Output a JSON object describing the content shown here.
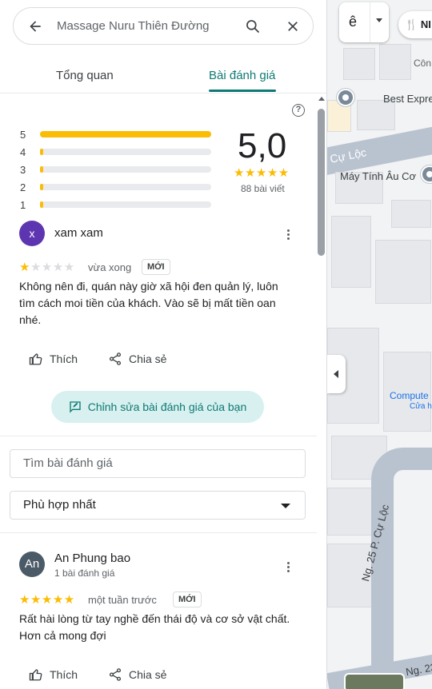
{
  "search": {
    "query": "Massage Nuru Thiên Đường"
  },
  "tabs": [
    {
      "label": "Tổng quan"
    },
    {
      "label": "Bài đánh giá"
    }
  ],
  "summary": {
    "score": "5,0",
    "count": "88 bài viết",
    "stars": "★★★★★",
    "histogram": [
      {
        "label": "5",
        "fraction": 1.0
      },
      {
        "label": "4",
        "fraction": 0.0
      },
      {
        "label": "3",
        "fraction": 0.0
      },
      {
        "label": "2",
        "fraction": 0.0
      },
      {
        "label": "1",
        "fraction": 0.0
      }
    ]
  },
  "my_review": {
    "avatar_letter": "x",
    "avatar_color": "#5e35b1",
    "name": "xam xam",
    "rating": 1,
    "stars_filled": "★",
    "stars_empty": "★★★★",
    "time": "vừa xong",
    "badge": "MỚI",
    "text": "Không nên đi, quán này giờ xã hội đen quản lý, luôn tìm cách moi tiền của khách. Vào sẽ bị mất tiền oan nhé.",
    "like_label": "Thích",
    "share_label": "Chia sẻ",
    "edit_label": "Chỉnh sửa bài đánh giá của bạn"
  },
  "filters": {
    "search_placeholder": "Tìm bài đánh giá",
    "sort_label": "Phù hợp nhất"
  },
  "reviews": [
    {
      "avatar_letter": "An",
      "avatar_color": "#4a5a66",
      "name": "An Phung bao",
      "meta": "1 bài đánh giá",
      "rating": 5,
      "stars": "★★★★★",
      "time": "một tuần trước",
      "badge": "MỚI",
      "text": "Rất hài lòng từ tay nghề đến thái độ và cơ sở vật chất. Hơn cả mong đợi",
      "like_label": "Thích",
      "share_label": "Chia sẻ"
    }
  ],
  "map": {
    "labels": {
      "con": "Côn",
      "best": "Best Expre",
      "cu_loc": "P. Cự Lộc",
      "may_tinh": "Máy Tính Âu Cơ",
      "computer": "Compute",
      "cua_hang": "Cửa h",
      "ng25": "Ng. 25 P. Cự Lộc",
      "ng23": "Ng. 23"
    },
    "chip_label": "NI",
    "tile_glyph": "ê",
    "colors": {
      "road": "#b9c3d0",
      "block": "#e6e8eb",
      "accent": "#1a73e8"
    }
  },
  "colors": {
    "accent": "#0e7a73",
    "star": "#fbbc04",
    "star_empty": "#dadce0"
  }
}
